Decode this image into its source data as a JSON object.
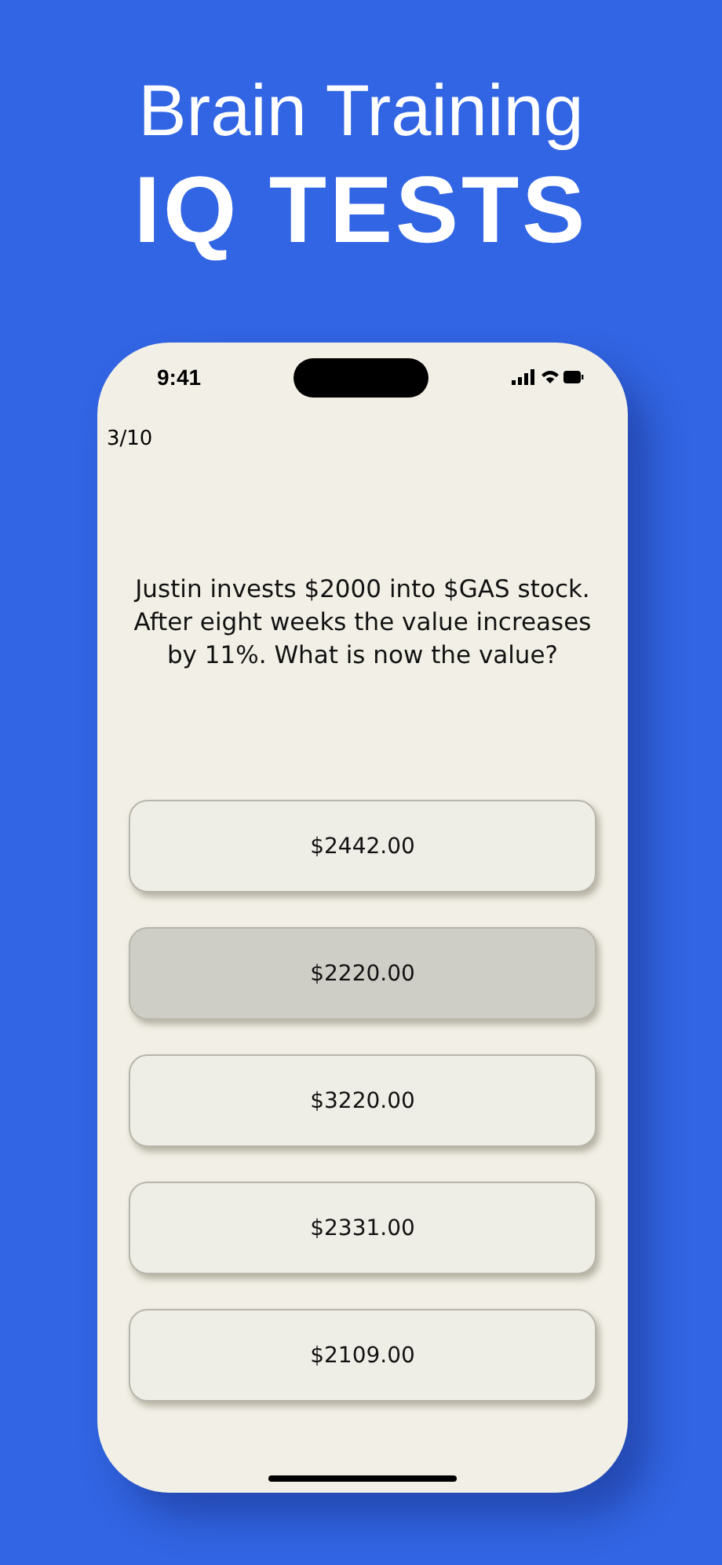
{
  "headline": {
    "line_1": "Brain Training",
    "line_2": "IQ TESTS"
  },
  "status_bar": {
    "time": "9:41"
  },
  "progress": "3/10",
  "question": "Justin invests $2000 into $GAS stock. After eight weeks the value increases by 11%. What is now the value?",
  "answers": [
    {
      "label": "$2442.00",
      "selected": false
    },
    {
      "label": "$2220.00",
      "selected": true
    },
    {
      "label": "$3220.00",
      "selected": false
    },
    {
      "label": "$2331.00",
      "selected": false
    },
    {
      "label": "$2109.00",
      "selected": false
    }
  ]
}
